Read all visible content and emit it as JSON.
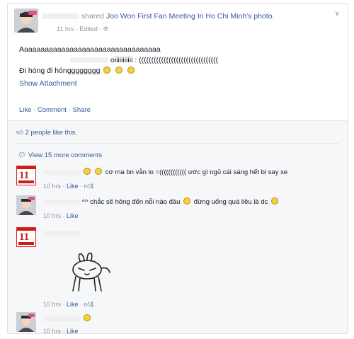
{
  "post": {
    "author_action": "shared",
    "page_name": "Joo Won First Fan Meeting In Ho Chi Minh",
    "object": "'s photo.",
    "time": "11 hrs",
    "edited": "Edited",
    "body_line1": "Aaaaaaaaaaaaaaaaaaaaaaaaaaaaaaaaaa",
    "body_line2": "oiiiiiiiiiii : ((((((((((((((((((((((((((((((((",
    "body_line3": "Đi hóng đi hóngggggggg",
    "show_attachment": "Show Attachment",
    "actions": {
      "like": "Like",
      "comment": "Comment",
      "share": "Share"
    }
  },
  "ufi": {
    "likes": "2 people like this.",
    "view_more": "View 15 more comments"
  },
  "comments": [
    {
      "text": "cơ ma bn vẫn lo =(((((((((((( ước gì ngủ cái sáng hết bị say xe",
      "time": "10 hrs",
      "like": "Like",
      "like_count": "1"
    },
    {
      "text": "^^ chắc sẽ hông đến nỗi nào đâu",
      "text2": "đừng uống quá liều là dc",
      "time": "10 hrs",
      "like": "Like"
    },
    {
      "time": "10 hrs",
      "like": "Like",
      "like_count": "1"
    },
    {
      "time": "10 hrs",
      "like": "Like"
    }
  ],
  "badge": {
    "number": "11"
  },
  "colors": {
    "link": "#365899",
    "meta": "#90949c",
    "accent_red": "#c81e1e"
  },
  "icons": [
    "chevron-down-icon",
    "globe-icon",
    "thumbs-up-icon",
    "comment-bubble-icon",
    "smiley-icon"
  ]
}
